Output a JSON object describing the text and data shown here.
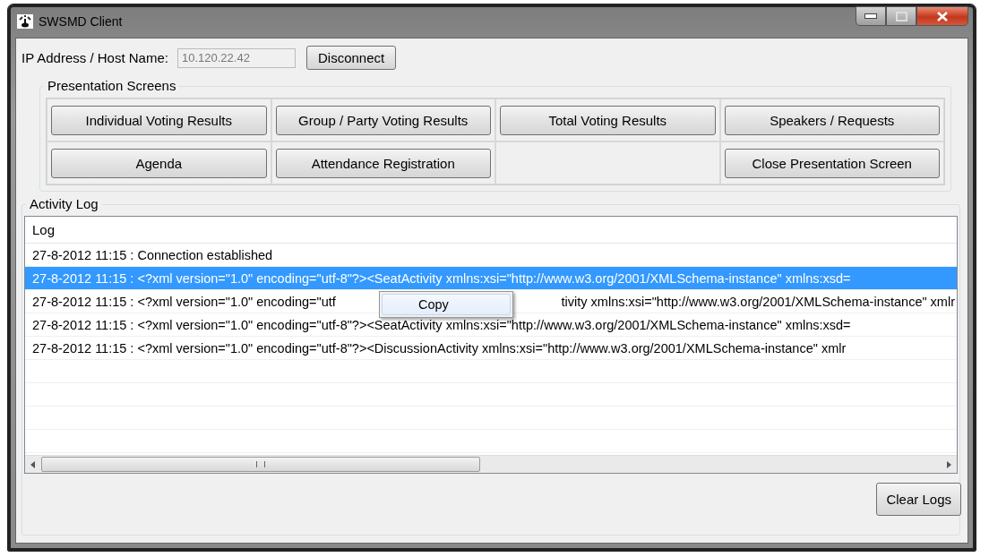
{
  "window": {
    "title": "SWSMD Client"
  },
  "connection": {
    "label": "IP Address / Host Name:",
    "value": "10.120.22.42",
    "button": "Disconnect"
  },
  "presentation_screens": {
    "title": "Presentation Screens",
    "buttons": [
      {
        "kind": "button",
        "label": "Individual Voting Results"
      },
      {
        "kind": "button",
        "label": "Group / Party Voting Results"
      },
      {
        "kind": "button",
        "label": "Total Voting Results"
      },
      {
        "kind": "button",
        "label": "Speakers / Requests"
      },
      {
        "kind": "button",
        "label": "Agenda"
      },
      {
        "kind": "button",
        "label": "Attendance Registration"
      },
      {
        "kind": "empty"
      },
      {
        "kind": "button",
        "label": "Close Presentation Screen"
      }
    ]
  },
  "activity_log": {
    "title": "Activity Log",
    "column": "Log",
    "rows": [
      {
        "selected": false,
        "segments": [
          "27-8-2012 11:15 : Connection established"
        ]
      },
      {
        "selected": true,
        "segments": [
          "27-8-2012 11:15 : <?xml version=\"1.0\" encoding=\"utf-8\"?><SeatActivity xmlns:xsi=\"http://www.w3.org/2001/XMLSchema-instance\" xmlns:xsd="
        ]
      },
      {
        "selected": false,
        "segments": [
          "27-8-2012 11:15 : <?xml version=\"1.0\" encoding=\"utf",
          "tivity xmlns:xsi=\"http://www.w3.org/2001/XMLSchema-instance\" xmlr"
        ]
      },
      {
        "selected": false,
        "segments": [
          "27-8-2012 11:15 : <?xml version=\"1.0\" encoding=\"utf-8\"?><SeatActivity xmlns:xsi=\"http://www.w3.org/2001/XMLSchema-instance\" xmlns:xsd="
        ]
      },
      {
        "selected": false,
        "segments": [
          "27-8-2012 11:15 : <?xml version=\"1.0\" encoding=\"utf-8\"?><DiscussionActivity xmlns:xsi=\"http://www.w3.org/2001/XMLSchema-instance\" xmlr"
        ]
      }
    ],
    "context_menu": {
      "items": [
        "Copy"
      ]
    },
    "button": "Clear Logs"
  }
}
